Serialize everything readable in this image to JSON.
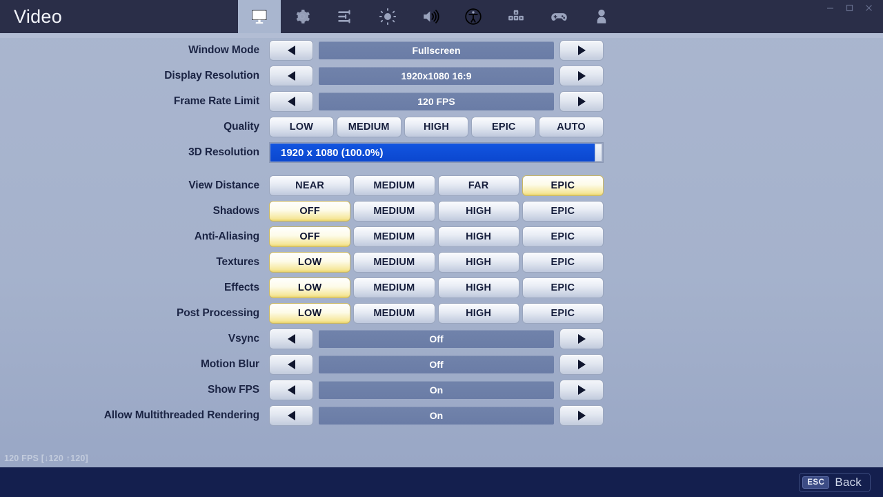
{
  "header": {
    "title": "Video",
    "tabs": [
      {
        "icon": "monitor-icon",
        "name": "tab-video",
        "active": true
      },
      {
        "icon": "gear-icon",
        "name": "tab-game",
        "active": false
      },
      {
        "icon": "sliders-icon",
        "name": "tab-brightness",
        "active": false
      },
      {
        "icon": "sun-icon",
        "name": "tab-display",
        "active": false
      },
      {
        "icon": "speaker-icon",
        "name": "tab-audio",
        "active": false
      },
      {
        "icon": "accessibility-icon",
        "name": "tab-accessibility",
        "active": false
      },
      {
        "icon": "keyboard-icon",
        "name": "tab-input",
        "active": false
      },
      {
        "icon": "gamepad-icon",
        "name": "tab-controller",
        "active": false
      },
      {
        "icon": "account-icon",
        "name": "tab-account",
        "active": false
      }
    ],
    "window_controls": [
      "minimize-icon",
      "maximize-icon",
      "close-icon"
    ]
  },
  "settings": [
    {
      "label": "Window Mode",
      "type": "stepper",
      "value": "Fullscreen",
      "prev": "◀",
      "next": "▶"
    },
    {
      "label": "Display Resolution",
      "type": "stepper",
      "value": "1920x1080 16:9",
      "prev": "◀",
      "next": "▶"
    },
    {
      "label": "Frame Rate Limit",
      "type": "stepper",
      "value": "120 FPS",
      "prev": "◀",
      "next": "▶"
    },
    {
      "label": "Quality",
      "type": "segments",
      "options": [
        "LOW",
        "MEDIUM",
        "HIGH",
        "EPIC",
        "AUTO"
      ],
      "selected": -1
    },
    {
      "label": "3D Resolution",
      "type": "slider",
      "value": "1920 x 1080 (100.0%)",
      "percent": 100
    },
    {
      "label": "View Distance",
      "type": "segments",
      "options": [
        "NEAR",
        "MEDIUM",
        "FAR",
        "EPIC"
      ],
      "selected": 3,
      "gap_before": true
    },
    {
      "label": "Shadows",
      "type": "segments",
      "options": [
        "OFF",
        "MEDIUM",
        "HIGH",
        "EPIC"
      ],
      "selected": 0
    },
    {
      "label": "Anti-Aliasing",
      "type": "segments",
      "options": [
        "OFF",
        "MEDIUM",
        "HIGH",
        "EPIC"
      ],
      "selected": 0
    },
    {
      "label": "Textures",
      "type": "segments",
      "options": [
        "LOW",
        "MEDIUM",
        "HIGH",
        "EPIC"
      ],
      "selected": 0
    },
    {
      "label": "Effects",
      "type": "segments",
      "options": [
        "LOW",
        "MEDIUM",
        "HIGH",
        "EPIC"
      ],
      "selected": 0
    },
    {
      "label": "Post Processing",
      "type": "segments",
      "options": [
        "LOW",
        "MEDIUM",
        "HIGH",
        "EPIC"
      ],
      "selected": 0
    },
    {
      "label": "Vsync",
      "type": "stepper",
      "value": "Off",
      "prev": "◀",
      "next": "▶"
    },
    {
      "label": "Motion Blur",
      "type": "stepper",
      "value": "Off",
      "prev": "◀",
      "next": "▶"
    },
    {
      "label": "Show FPS",
      "type": "stepper",
      "value": "On",
      "prev": "◀",
      "next": "▶"
    },
    {
      "label": "Allow Multithreaded Rendering",
      "type": "stepper",
      "value": "On",
      "prev": "◀",
      "next": "▶"
    }
  ],
  "fps_counter": "120 FPS [↓120 ↑120]",
  "footer": {
    "back_key": "ESC",
    "back_label": "Back"
  },
  "colors": {
    "header_bg": "#2a2e48",
    "page_bg": "#a9b6cf",
    "footer_bg": "#141f4e",
    "slider_blue": "#0b4fd6",
    "selected_gold": "#f6e79a",
    "value_bar": "#6f81a9"
  }
}
